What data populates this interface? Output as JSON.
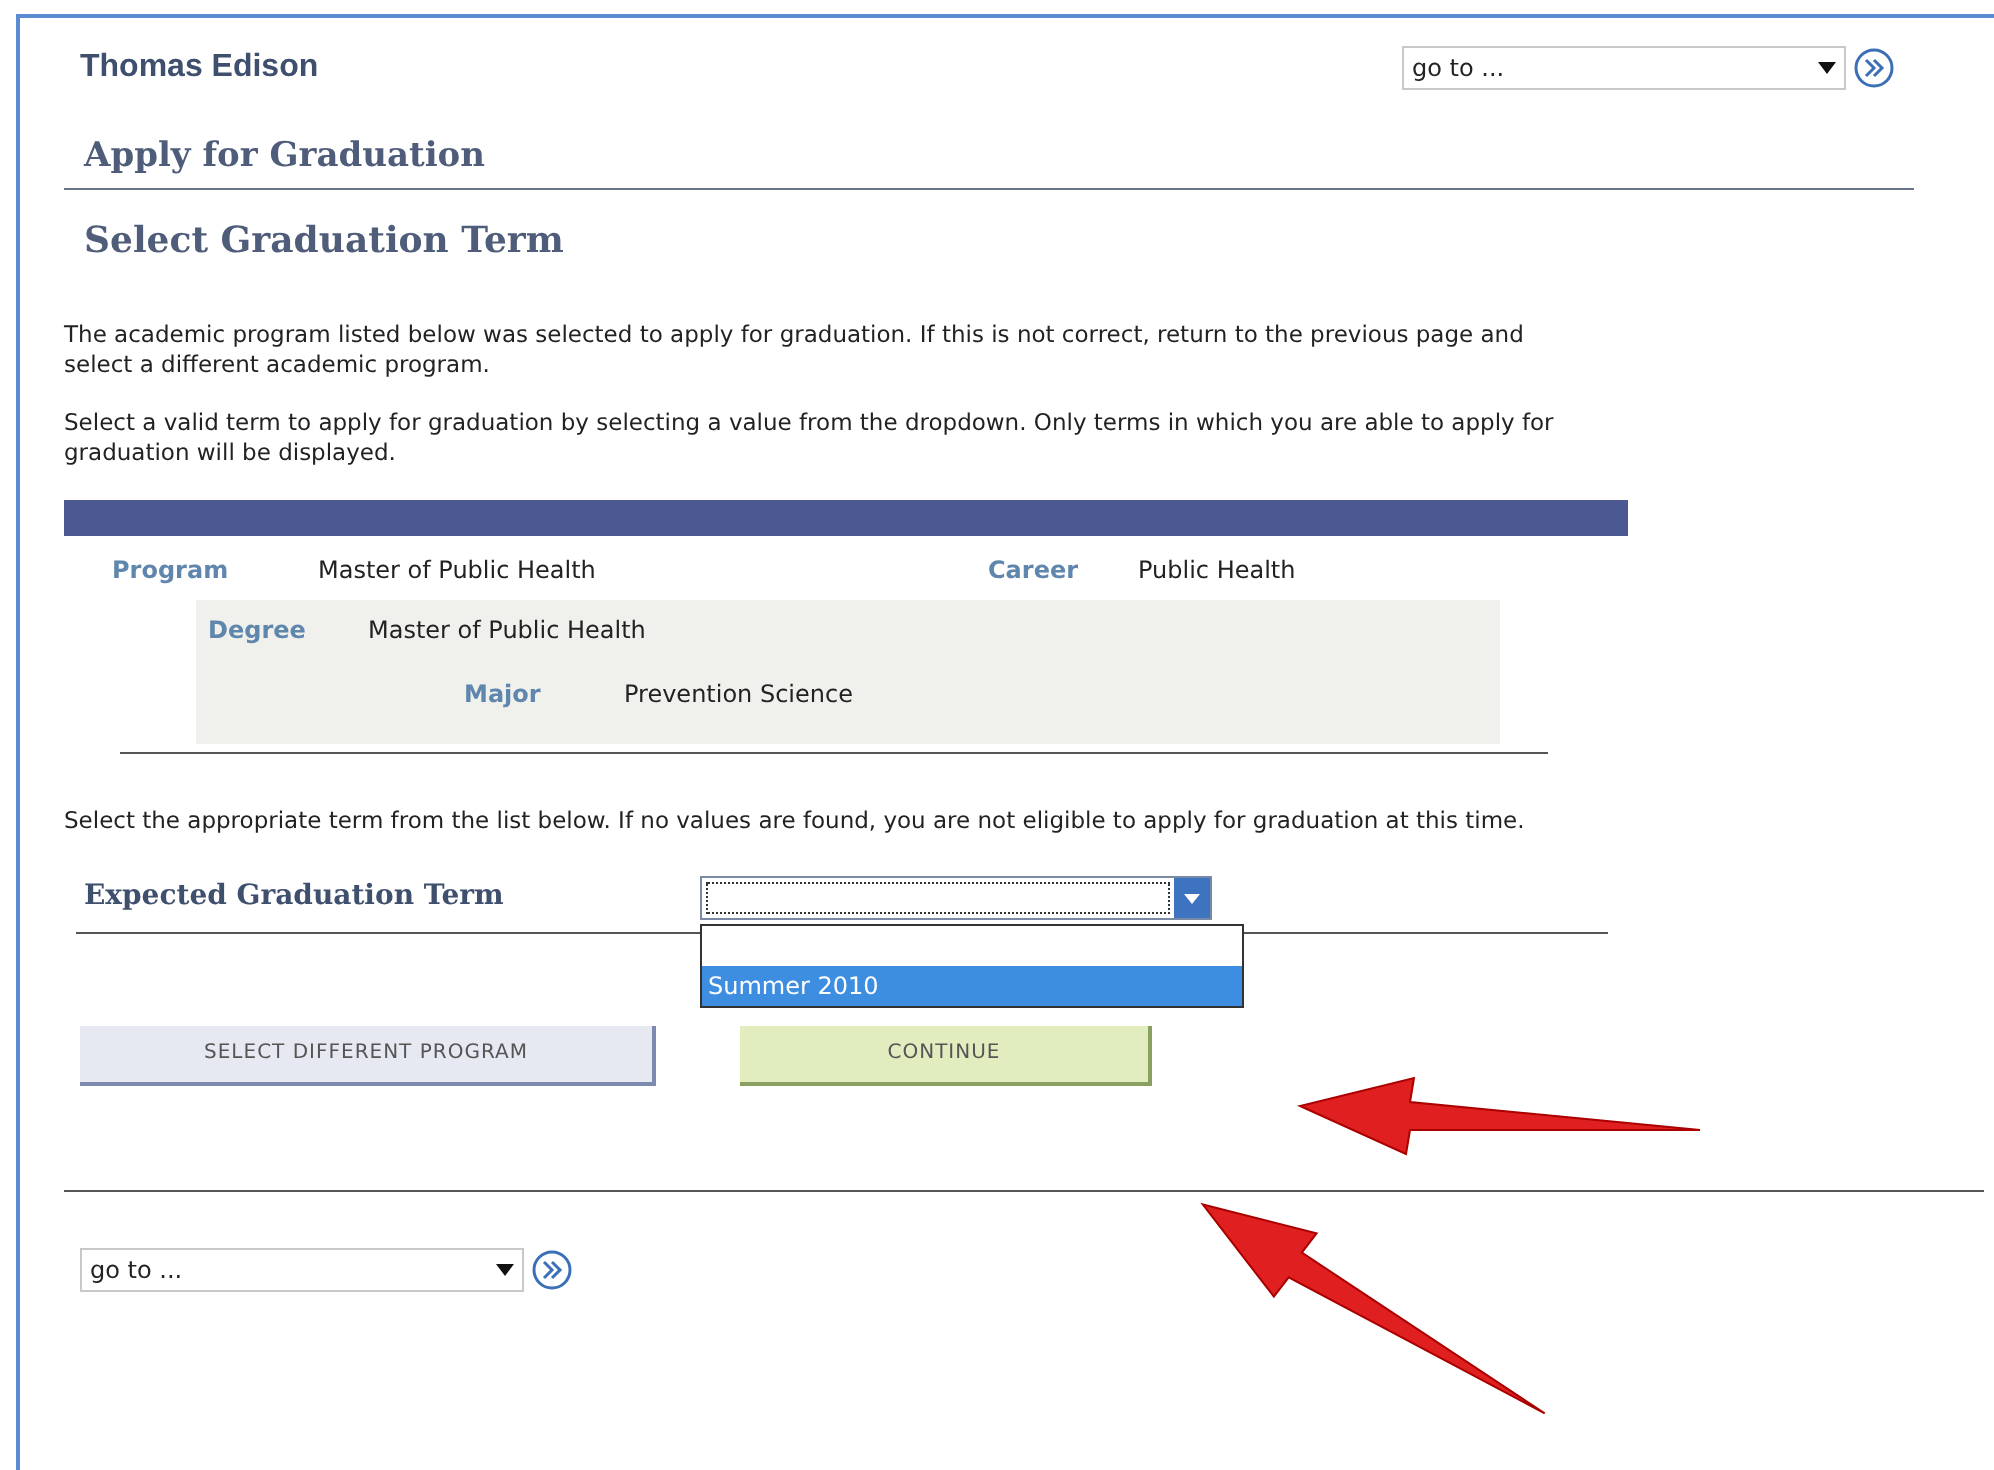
{
  "user_name": "Thomas Edison",
  "top_nav": {
    "value": "go to ..."
  },
  "page_title": "Apply for Graduation",
  "section_title": "Select Graduation Term",
  "intro_paragraphs": [
    "The academic program listed below was selected to apply for graduation. If this is not correct, return to the previous page and select a different academic program.",
    "Select a valid term to apply for graduation by selecting a value from the dropdown. Only terms in which you are able to apply for graduation will be displayed."
  ],
  "program": {
    "program_label": "Program",
    "program_value": "Master of Public Health",
    "career_label": "Career",
    "career_value": "Public Health",
    "degree_label": "Degree",
    "degree_value": "Master of Public Health",
    "major_label": "Major",
    "major_value": "Prevention Science"
  },
  "term_instructions": "Select the appropriate term from the list below. If no values are found, you are not eligible to apply for graduation at this time.",
  "term_field": {
    "label": "Expected Graduation Term",
    "expanded": true,
    "options": [
      {
        "label": "Summer 2010",
        "selected": true
      }
    ]
  },
  "buttons": [
    {
      "label": "SELECT DIFFERENT PROGRAM",
      "kind": "secondary"
    },
    {
      "label": "CONTINUE",
      "kind": "primary"
    }
  ],
  "bottom_nav": {
    "value": "go to ..."
  }
}
